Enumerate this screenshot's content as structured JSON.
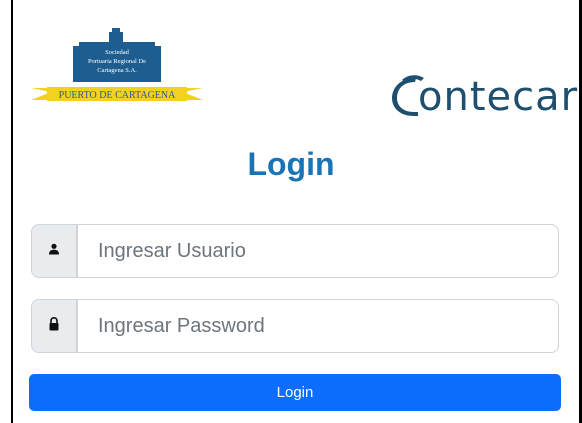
{
  "logos": {
    "left_org_text": "Sociedad Portuaria Regional De Cartagena S.A.",
    "left_banner_text": "PUERTO DE CARTAGENA",
    "right_brand_text": "ontecar"
  },
  "login": {
    "title": "Login",
    "username": {
      "placeholder": "Ingresar Usuario",
      "value": "",
      "icon": "user-icon"
    },
    "password": {
      "placeholder": "Ingresar Password",
      "value": "",
      "icon": "lock-icon"
    },
    "submit_label": "Login"
  },
  "colors": {
    "title": "#1a73b5",
    "button": "#0d6efd",
    "addon_bg": "#e9ecef",
    "contecar": "#1f4f6f"
  }
}
